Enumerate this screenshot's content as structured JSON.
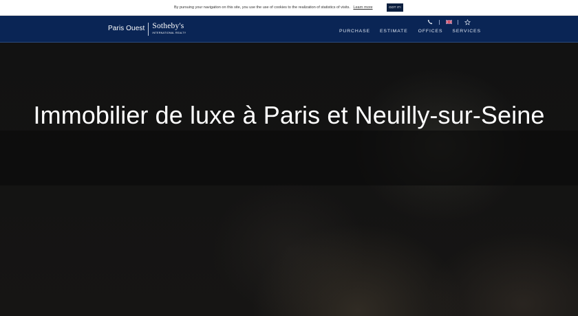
{
  "cookie_bar": {
    "message": "By pursuing your navigation on this site, you use the use of cookies to the realization of statistics of visits.",
    "learn_more": "Learn more",
    "button": "GOT IT!"
  },
  "header": {
    "brand_local": "Paris Ouest",
    "brand_name": "Sotheby's",
    "brand_sub": "INTERNATIONAL REALTY",
    "utility_icons": [
      "phone-icon",
      "uk-flag-icon",
      "star-icon"
    ],
    "nav": [
      "PURCHASE",
      "ESTIMATE",
      "OFFICES",
      "SERVICES"
    ]
  },
  "hero": {
    "title": "Immobilier de luxe à Paris et Neuilly-sur-Seine"
  },
  "colors": {
    "header_bg": "#0a2555",
    "cookie_button_bg": "#0c1f3f",
    "hero_text": "#ffffff"
  }
}
